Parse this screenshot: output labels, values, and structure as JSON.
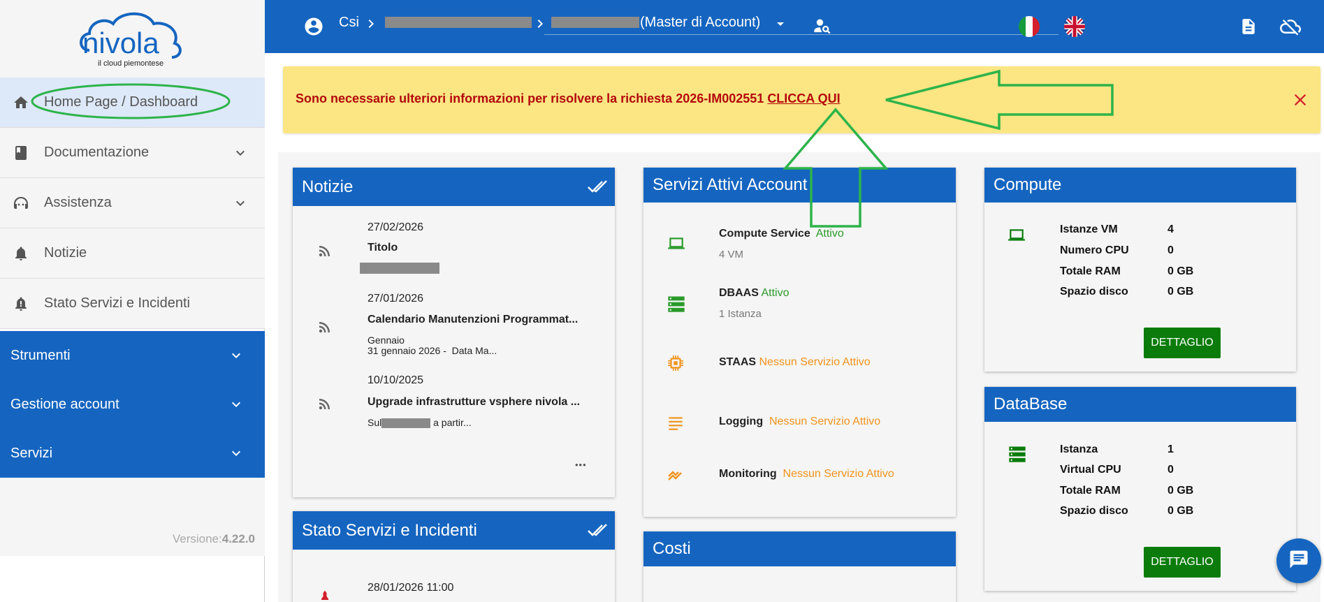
{
  "logo": {
    "brand": "nivola",
    "tagline": "il cloud piemontese"
  },
  "sidebar": {
    "items": [
      {
        "label": "Home Page / Dashboard"
      },
      {
        "label": "Documentazione"
      },
      {
        "label": "Assistenza"
      },
      {
        "label": "Notizie"
      },
      {
        "label": "Stato Servizi e Incidenti"
      }
    ],
    "sections": [
      {
        "label": "Strumenti"
      },
      {
        "label": "Gestione account"
      },
      {
        "label": "Servizi"
      }
    ],
    "version_label": "Versione:",
    "version_value": "4.22.0"
  },
  "topbar": {
    "org": "Csi",
    "account_suffix": "(Master di Account)"
  },
  "alert": {
    "message": "Sono necessarie ulteriori informazioni per risolvere la richiesta 2026-IM002551",
    "link": "CLICCA QUI"
  },
  "notizie": {
    "title": "Notizie",
    "items": [
      {
        "date": "27/02/2026",
        "title": "Titolo",
        "excerpt": ""
      },
      {
        "date": "27/01/2026",
        "title": "Calendario Manutenzioni Programmat...",
        "excerpt": "Gennaio",
        "excerpt2": "31 gennaio 2026 -  Data Ma..."
      },
      {
        "date": "10/10/2025",
        "title": "Upgrade infrastrutture vsphere nivola ...",
        "excerpt_a": "Sul",
        "excerpt_b": " a partir..."
      }
    ],
    "more": "•••"
  },
  "stato": {
    "title": "Stato Servizi e Incidenti",
    "items": [
      {
        "date": "28/01/2026 11:00"
      }
    ]
  },
  "servizi": {
    "title": "Servizi Attivi Account",
    "items": [
      {
        "name": "Compute Service",
        "status": "Attivo",
        "detail": "4 VM",
        "icon": "laptop-icon",
        "color": "#2a9a2a"
      },
      {
        "name": "DBAAS",
        "status": "Attivo",
        "detail": "1 Istanza",
        "icon": "database-icon",
        "color": "#2a9a2a"
      },
      {
        "name": "STAAS",
        "status": "Nessun Servizio Attivo",
        "detail": "",
        "icon": "chip-icon",
        "color": "#f0931c"
      },
      {
        "name": "Logging",
        "status": "Nessun Servizio Attivo",
        "detail": "",
        "icon": "lines-icon",
        "color": "#f0931c"
      },
      {
        "name": "Monitoring",
        "status": "Nessun Servizio Attivo",
        "detail": "",
        "icon": "trend-icon",
        "color": "#f0931c"
      }
    ]
  },
  "costi": {
    "title": "Costi"
  },
  "compute": {
    "title": "Compute",
    "rows": [
      {
        "label": "Istanze VM",
        "value": "4"
      },
      {
        "label": "Numero CPU",
        "value": "0"
      },
      {
        "label": "Totale RAM",
        "value": "0 GB"
      },
      {
        "label": "Spazio disco",
        "value": "0 GB"
      }
    ],
    "button": "DETTAGLIO"
  },
  "database": {
    "title": "DataBase",
    "rows": [
      {
        "label": "Istanza",
        "value": "1"
      },
      {
        "label": "Virtual CPU",
        "value": "0"
      },
      {
        "label": "Totale RAM",
        "value": "0 GB"
      },
      {
        "label": "Spazio disco",
        "value": "0 GB"
      }
    ],
    "button": "DETTAGLIO"
  },
  "colors": {
    "primary": "#1565c0",
    "alert_bg": "#fbe683",
    "alert_text": "#b3080c",
    "active": "#2a9a2a",
    "inactive": "#f0931c",
    "button": "#0b7c0b",
    "annotation": "#2db34a"
  }
}
